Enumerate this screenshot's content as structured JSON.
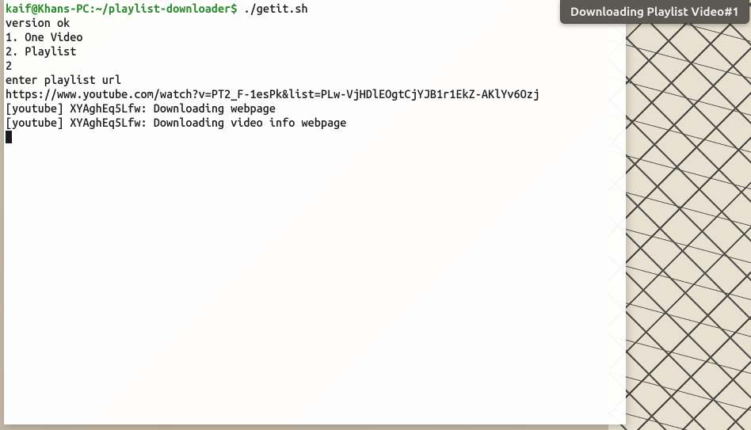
{
  "terminal": {
    "prompt": {
      "user_host": "kaif@Khans-PC",
      "separator": ":",
      "path": "~/playlist-downloader",
      "dollar": "$"
    },
    "command": "./getit.sh",
    "lines": [
      "version ok",
      "1. One Video",
      "2. Playlist",
      "2",
      "enter playlist url",
      "https://www.youtube.com/watch?v=PT2_F-1esPk&list=PLw-VjHDlEOgtCjYJB1r1EkZ-AKlYv6Ozj",
      "[youtube] XYAghEq5Lfw: Downloading webpage",
      "[youtube] XYAghEq5Lfw: Downloading video info webpage"
    ]
  },
  "notification": {
    "text": "Downloading Playlist Video#1"
  }
}
